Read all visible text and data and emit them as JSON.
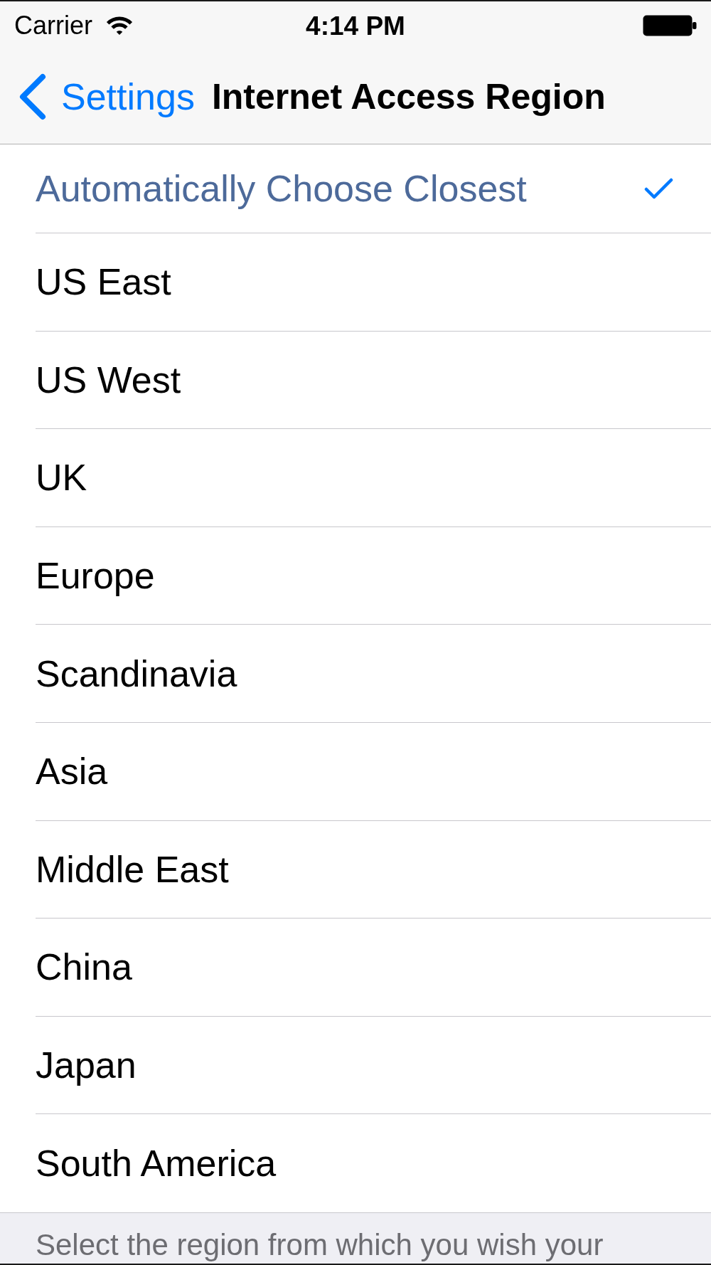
{
  "status_bar": {
    "carrier": "Carrier",
    "time": "4:14 PM"
  },
  "nav_bar": {
    "back_label": "Settings",
    "title": "Internet Access Region"
  },
  "regions": [
    {
      "label": "Automatically Choose Closest",
      "selected": true
    },
    {
      "label": "US East",
      "selected": false
    },
    {
      "label": "US West",
      "selected": false
    },
    {
      "label": "UK",
      "selected": false
    },
    {
      "label": "Europe",
      "selected": false
    },
    {
      "label": "Scandinavia",
      "selected": false
    },
    {
      "label": "Asia",
      "selected": false
    },
    {
      "label": "Middle East",
      "selected": false
    },
    {
      "label": "China",
      "selected": false
    },
    {
      "label": "Japan",
      "selected": false
    },
    {
      "label": "South America",
      "selected": false
    }
  ],
  "footer": {
    "text": "Select the region from which you wish your"
  }
}
